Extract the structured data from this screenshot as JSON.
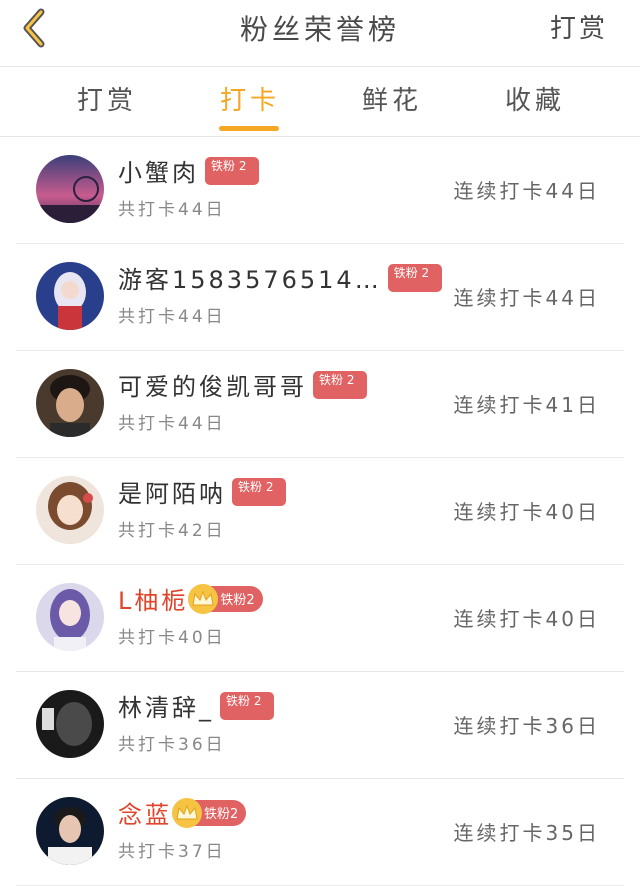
{
  "header": {
    "title": "粉丝荣誉榜",
    "action": "打赏",
    "back_icon": "chevron-left-icon",
    "accent": "#f5a623"
  },
  "tabs": [
    {
      "label": "打赏",
      "active": false
    },
    {
      "label": "打卡",
      "active": true
    },
    {
      "label": "鲜花",
      "active": false
    },
    {
      "label": "收藏",
      "active": false
    }
  ],
  "rows": [
    {
      "name": "小蟹肉",
      "badge": "铁粉 2",
      "total": "共打卡44日",
      "streak": "连续打卡44日",
      "vip": false
    },
    {
      "name": "游客1583576514…",
      "badge": "铁粉 2",
      "total": "共打卡44日",
      "streak": "连续打卡44日",
      "vip": false
    },
    {
      "name": "可爱的俊凯哥哥",
      "badge": "铁粉 2",
      "total": "共打卡44日",
      "streak": "连续打卡41日",
      "vip": false
    },
    {
      "name": "是阿陌呐",
      "badge": "铁粉 2",
      "total": "共打卡42日",
      "streak": "连续打卡40日",
      "vip": false
    },
    {
      "name": "L柚栀",
      "badge": "铁粉2",
      "total": "共打卡40日",
      "streak": "连续打卡40日",
      "vip": true
    },
    {
      "name": "林清辞_",
      "badge": "铁粉 2",
      "total": "共打卡36日",
      "streak": "连续打卡36日",
      "vip": false
    },
    {
      "name": "念蓝",
      "badge": "铁粉2",
      "total": "共打卡37日",
      "streak": "连续打卡35日",
      "vip": true
    }
  ]
}
